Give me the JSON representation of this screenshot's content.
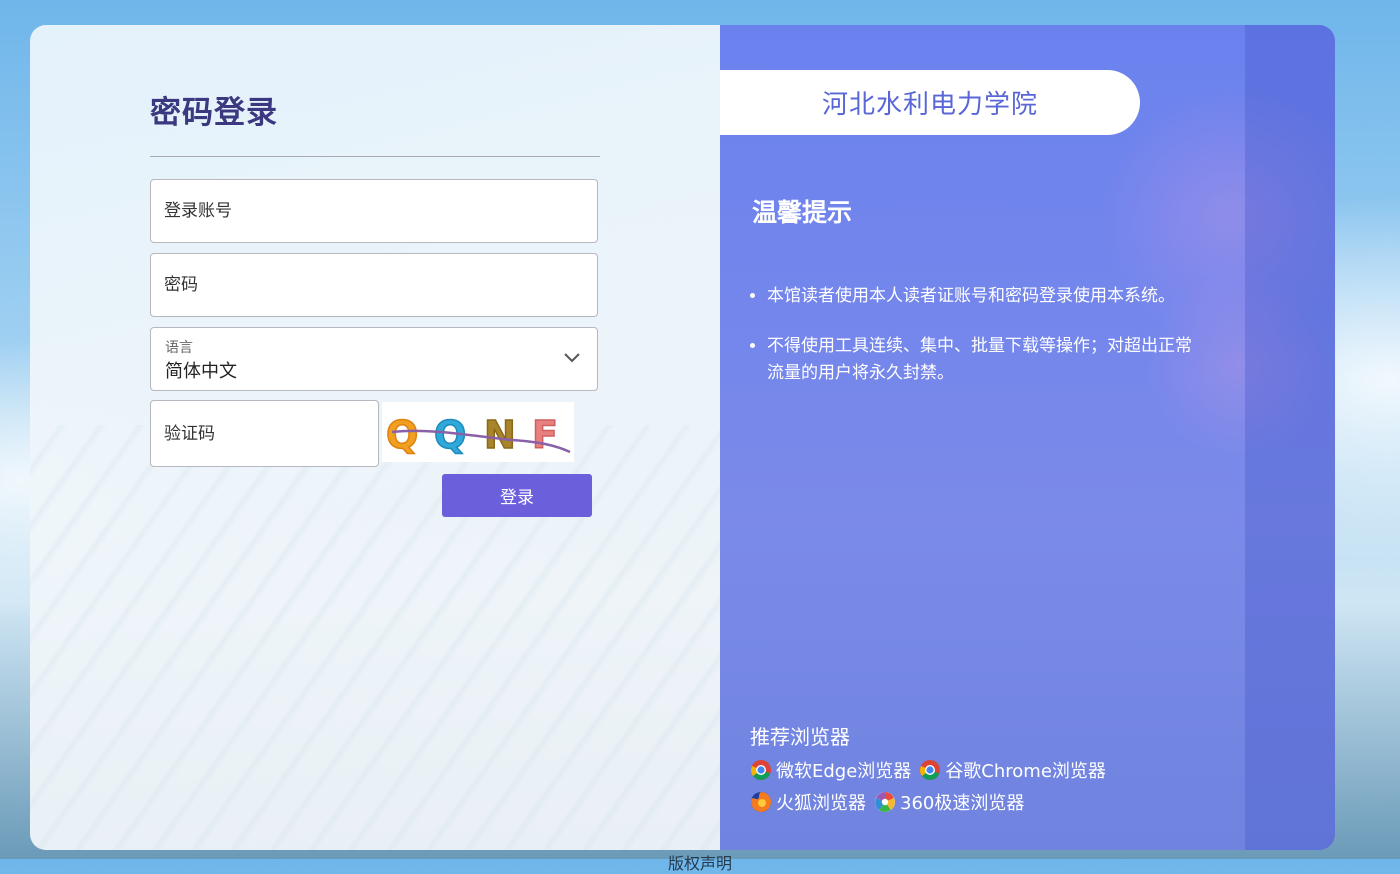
{
  "login": {
    "title": "密码登录",
    "account_placeholder": "登录账号",
    "password_placeholder": "密码",
    "language_label": "语言",
    "language_value": "简体中文",
    "captcha_placeholder": "验证码",
    "captcha_text": "QQNF",
    "submit_label": "登录"
  },
  "info": {
    "school_name": "河北水利电力学院",
    "tips_title": "温馨提示",
    "tips": [
      "本馆读者使用本人读者证账号和密码登录使用本系统。",
      "不得使用工具连续、集中、批量下载等操作；对超出正常流量的用户将永久封禁。"
    ],
    "browsers_title": "推荐浏览器",
    "browsers": [
      {
        "name": "微软Edge浏览器",
        "icon": "chrome-icon"
      },
      {
        "name": "谷歌Chrome浏览器",
        "icon": "chrome-icon"
      },
      {
        "name": "火狐浏览器",
        "icon": "firefox-icon"
      },
      {
        "name": "360极速浏览器",
        "icon": "360-browser-icon"
      }
    ]
  },
  "footer": {
    "text": "版权声明"
  },
  "colors": {
    "accent": "#6c5fdc",
    "title": "#3b3880",
    "panel": "#6b82ee",
    "school_text": "#5967d6"
  }
}
